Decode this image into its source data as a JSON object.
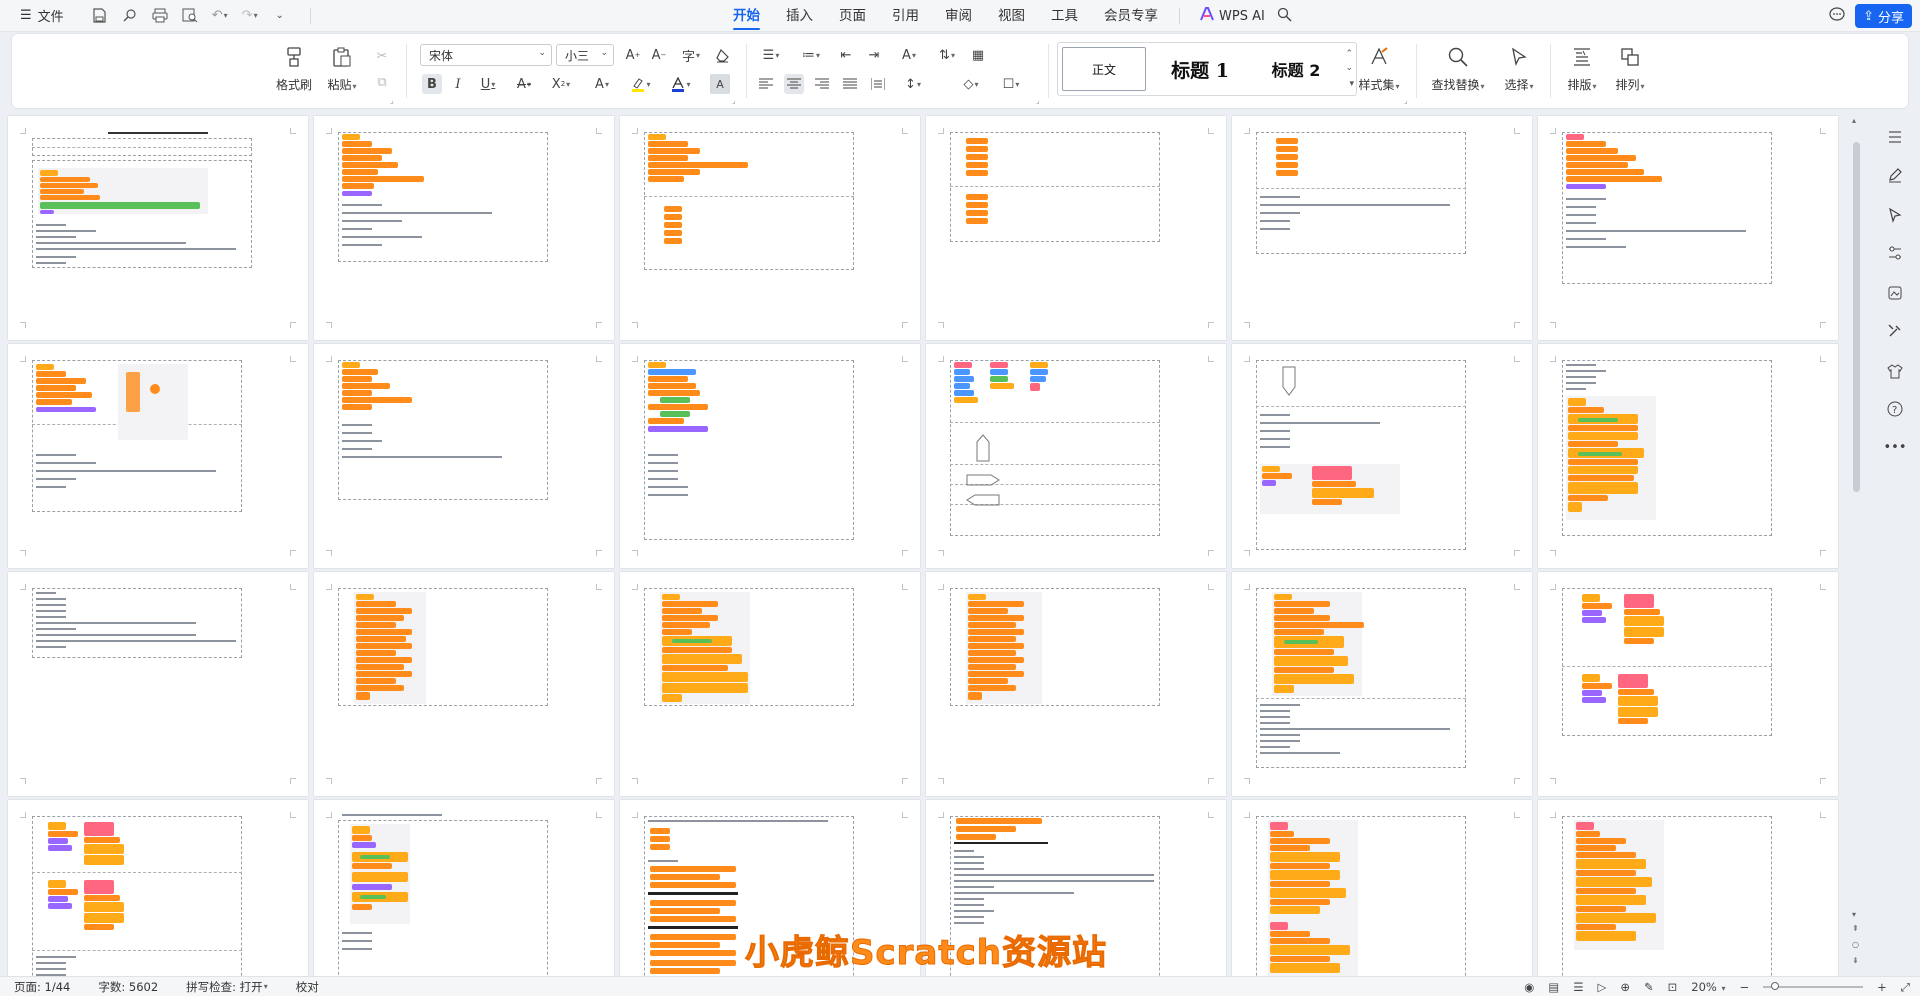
{
  "menubar": {
    "file_label": "文件",
    "tabs": [
      {
        "label": "开始",
        "active": true
      },
      {
        "label": "插入",
        "active": false
      },
      {
        "label": "页面",
        "active": false
      },
      {
        "label": "引用",
        "active": false
      },
      {
        "label": "审阅",
        "active": false
      },
      {
        "label": "视图",
        "active": false
      },
      {
        "label": "工具",
        "active": false
      },
      {
        "label": "会员专享",
        "active": false
      }
    ],
    "wps_ai_label": "WPS AI",
    "share_label": "分享",
    "accent_color": "#1865f2"
  },
  "ribbon": {
    "format_painter_label": "格式刷",
    "paste_label": "粘贴",
    "font_name": "宋体",
    "font_size": "小三",
    "styles": {
      "normal": "正文",
      "heading1": "标题 1",
      "heading2": "标题 2"
    },
    "style_set_label": "样式集",
    "find_replace_label": "查找替换",
    "select_label": "选择",
    "layout_label": "排版",
    "arrange_label": "排列"
  },
  "document": {
    "columns": 6,
    "rows_visible": 4,
    "block_colors": {
      "control": "#ffab19",
      "events": "#ffbf00",
      "motion": "#4c97ff",
      "operators": "#59c059",
      "looks": "#9966ff",
      "pen": "#ff6680",
      "orange": "#ff8c1a"
    }
  },
  "watermark": "小虎鲸Scratch资源站",
  "statusbar": {
    "page": "页面: 1/44",
    "word_count": "字数: 5602",
    "spell_check": "拼写检查: 打开",
    "proofread": "校对",
    "zoom": "20%"
  }
}
